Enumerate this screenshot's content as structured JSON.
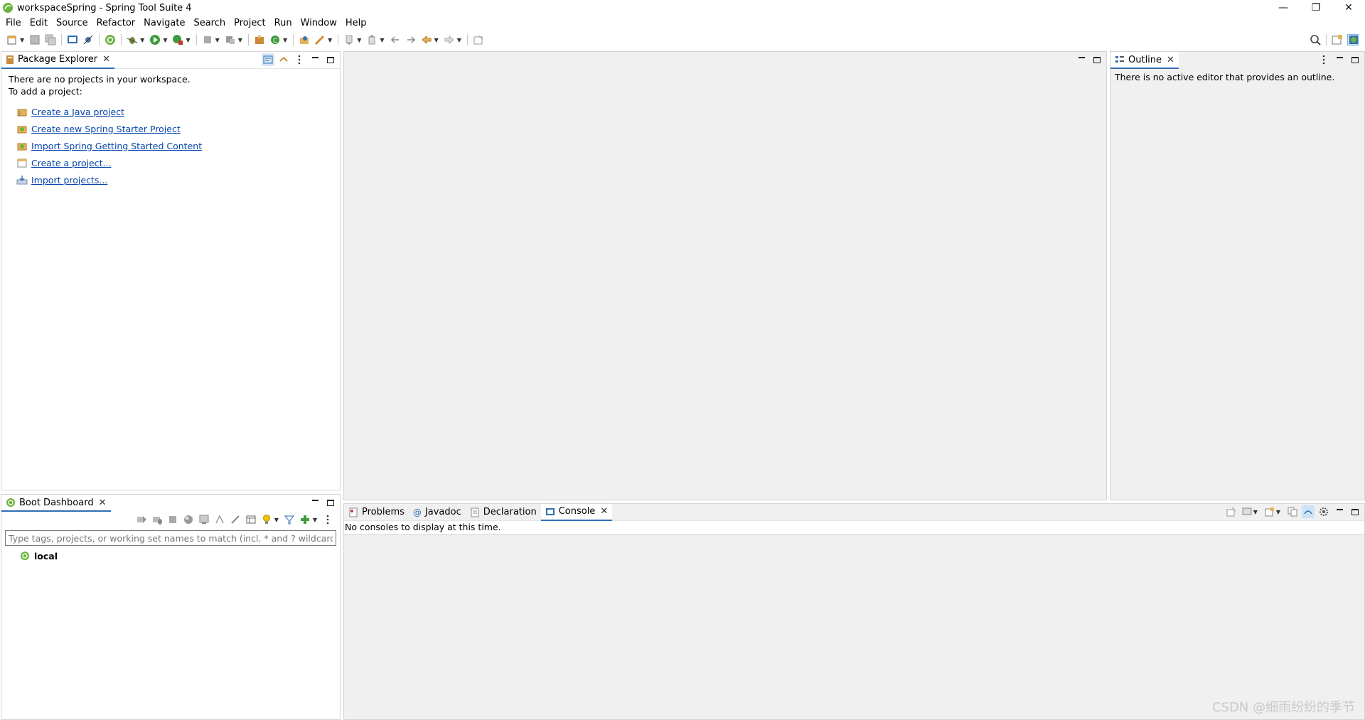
{
  "window": {
    "title": "workspaceSpring - Spring Tool Suite 4",
    "minimize_label": "—",
    "restore_label": "❐",
    "close_label": "✕"
  },
  "menubar": {
    "items": [
      "File",
      "Edit",
      "Source",
      "Refactor",
      "Navigate",
      "Search",
      "Project",
      "Run",
      "Window",
      "Help"
    ]
  },
  "package_explorer": {
    "tab_label": "Package Explorer",
    "line1": "There are no projects in your workspace.",
    "line2": "To add a project:",
    "links": [
      {
        "label": "Create a Java project",
        "icon": "java-project-icon"
      },
      {
        "label": "Create new Spring Starter Project",
        "icon": "spring-starter-icon"
      },
      {
        "label": "Import Spring Getting Started Content",
        "icon": "spring-import-icon"
      },
      {
        "label": "Create a project...",
        "icon": "new-project-icon"
      },
      {
        "label": "Import projects...",
        "icon": "import-projects-icon"
      }
    ]
  },
  "outline": {
    "tab_label": "Outline",
    "message": "There is no active editor that provides an outline."
  },
  "boot_dashboard": {
    "tab_label": "Boot Dashboard",
    "filter_placeholder": "Type tags, projects, or working set names to match (incl. * and ? wildcards)",
    "tree_root": "local"
  },
  "bottom_panel": {
    "tabs": [
      {
        "label": "Problems",
        "icon": "problems-icon"
      },
      {
        "label": "Javadoc",
        "icon": "javadoc-icon"
      },
      {
        "label": "Declaration",
        "icon": "declaration-icon"
      },
      {
        "label": "Console",
        "icon": "console-icon",
        "active": true
      }
    ],
    "console_message": "No consoles to display at this time."
  },
  "watermark": "CSDN @细雨纷纷的季节",
  "colors": {
    "spring_green": "#6db33f",
    "link_blue": "#0645ad",
    "editor_bg": "#f0f0f0",
    "active_tab_underline": "#2f6fb6"
  }
}
